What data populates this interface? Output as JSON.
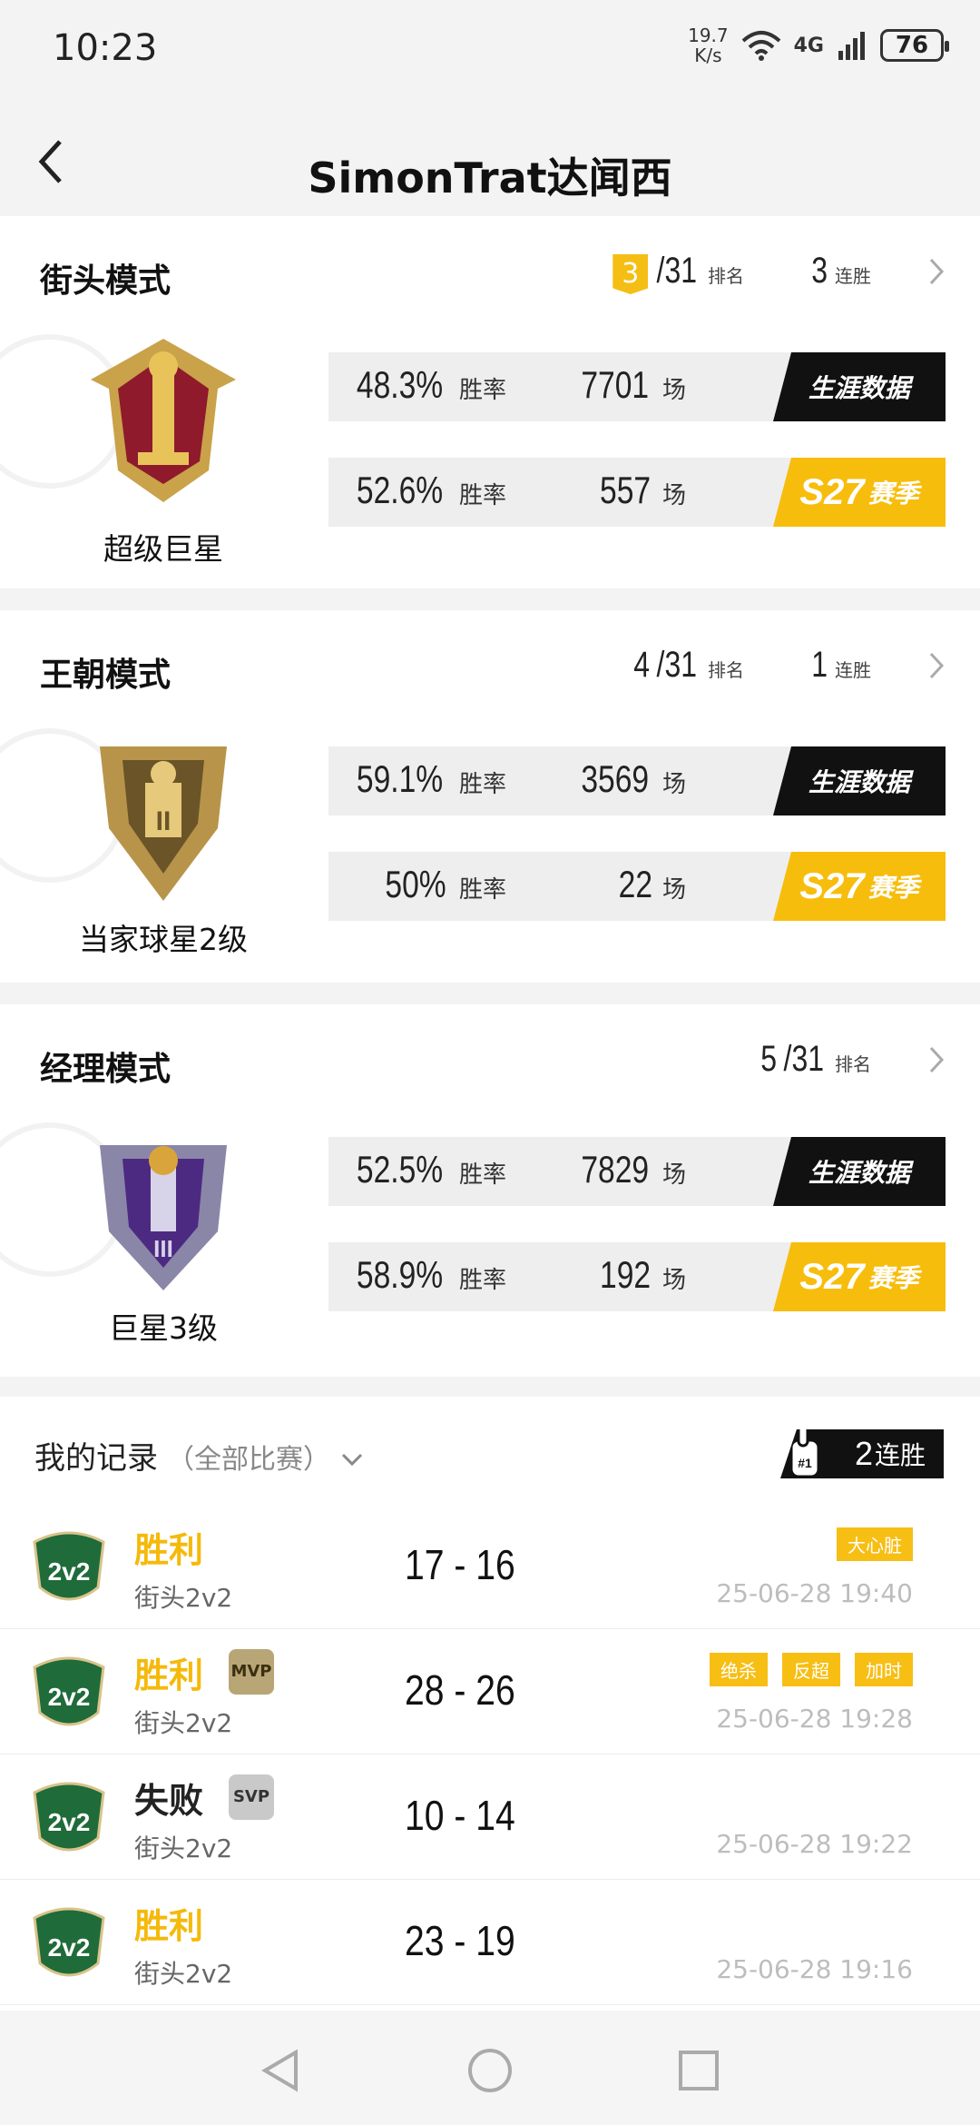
{
  "status": {
    "time": "10:23",
    "speed_top": "19.7",
    "speed_bottom": "K/s",
    "network": "4G",
    "battery": "76"
  },
  "header": {
    "title": "SimonTrat达闻西"
  },
  "modes": [
    {
      "title": "街头模式",
      "rank": "3",
      "rank_total": "/31",
      "rank_label": "排名",
      "streak": "3",
      "streak_label": "连胜",
      "tier": "超级巨星",
      "career": {
        "rate": "48.3%",
        "rate_label": "胜率",
        "games": "7701",
        "games_label": "场",
        "tag": "生涯数据"
      },
      "season": {
        "rate": "52.6%",
        "rate_label": "胜率",
        "games": "557",
        "games_label": "场",
        "tag_s": "S27",
        "tag": "赛季"
      }
    },
    {
      "title": "王朝模式",
      "rank": "4",
      "rank_total": "/31",
      "rank_label": "排名",
      "streak": "1",
      "streak_label": "连胜",
      "tier": "当家球星2级",
      "career": {
        "rate": "59.1%",
        "rate_label": "胜率",
        "games": "3569",
        "games_label": "场",
        "tag": "生涯数据"
      },
      "season": {
        "rate": "50%",
        "rate_label": "胜率",
        "games": "22",
        "games_label": "场",
        "tag_s": "S27",
        "tag": "赛季"
      }
    },
    {
      "title": "经理模式",
      "rank": "5",
      "rank_total": "/31",
      "rank_label": "排名",
      "tier": "巨星3级",
      "career": {
        "rate": "52.5%",
        "rate_label": "胜率",
        "games": "7829",
        "games_label": "场",
        "tag": "生涯数据"
      },
      "season": {
        "rate": "58.9%",
        "rate_label": "胜率",
        "games": "192",
        "games_label": "场",
        "tag_s": "S27",
        "tag": "赛季"
      }
    }
  ],
  "records": {
    "title": "我的记录",
    "filter": "（全部比赛）",
    "streak": "2",
    "streak_label": "连胜",
    "matches": [
      {
        "result": "胜利",
        "mode": "街头2v2",
        "score": "17 - 16",
        "date": "25-06-28 19:40",
        "labels": [
          "大心脏"
        ]
      },
      {
        "result": "胜利",
        "mode": "街头2v2",
        "score": "28 - 26",
        "date": "25-06-28 19:28",
        "badge": "MVP",
        "labels": [
          "绝杀",
          "反超",
          "加时"
        ]
      },
      {
        "result": "失败",
        "mode": "街头2v2",
        "score": "10 - 14",
        "date": "25-06-28 19:22",
        "badge": "SVP",
        "labels": []
      },
      {
        "result": "胜利",
        "mode": "街头2v2",
        "score": "23 - 19",
        "date": "25-06-28 19:16",
        "labels": []
      }
    ]
  },
  "logo_text": "2v2",
  "colors": {
    "accent": "#f5be14",
    "dark": "#111111",
    "win": "#f5b90a"
  }
}
